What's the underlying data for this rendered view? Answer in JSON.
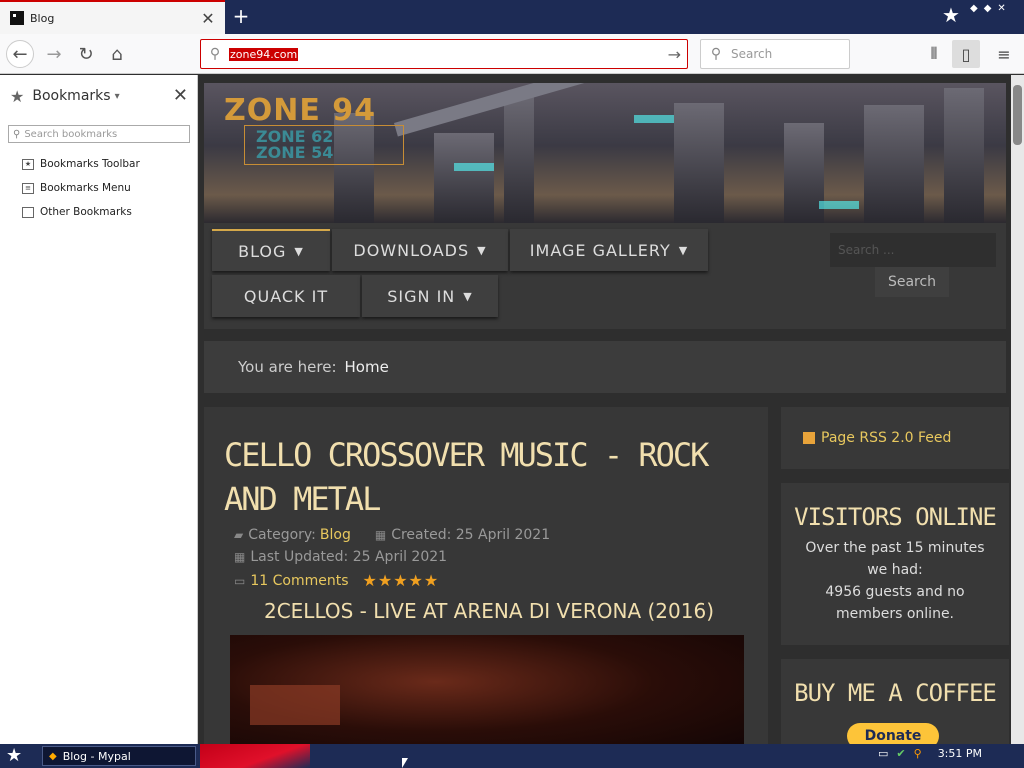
{
  "browser": {
    "tab_title": "Blog",
    "url": "zone94.com",
    "search_placeholder": "Search"
  },
  "sidebar": {
    "title": "Bookmarks",
    "search_placeholder": "Search bookmarks",
    "items": [
      {
        "label": "Bookmarks Toolbar"
      },
      {
        "label": "Bookmarks Menu"
      },
      {
        "label": "Other Bookmarks"
      }
    ]
  },
  "site": {
    "logo": "ZONE 94",
    "logo_lines": [
      "ZONE 62",
      "ZONE 54"
    ],
    "menu": [
      {
        "label": "BLOG"
      },
      {
        "label": "DOWNLOADS"
      },
      {
        "label": "IMAGE GALLERY"
      },
      {
        "label": "QUACK IT"
      },
      {
        "label": "SIGN IN"
      }
    ],
    "search_placeholder": "Search ...",
    "search_button": "Search",
    "breadcrumb_prefix": "You are here:",
    "breadcrumb_current": "Home"
  },
  "article": {
    "title": "CELLO CROSSOVER MUSIC - ROCK AND METAL",
    "category_label": "Category:",
    "category": "Blog",
    "created": "Created: 25 April 2021",
    "updated": "Last Updated: 25 April 2021",
    "comments": "11 Comments",
    "rating_stars": 5,
    "rating_glyphs": "★★★★★",
    "subtitle": "2CELLOS - LIVE AT ARENA DI VERONA (2016)"
  },
  "rightcol": {
    "rss": "Page RSS 2.0 Feed",
    "visitors_title": "VISITORS ONLINE",
    "visitors_line1": "Over the past 15 minutes we had:",
    "visitors_line2": "4956 guests and no members online.",
    "coffee_title": "BUY ME A COFFEE",
    "donate": "Donate"
  },
  "taskbar": {
    "item": "Blog - Mypal",
    "clock": "3:51 PM"
  }
}
